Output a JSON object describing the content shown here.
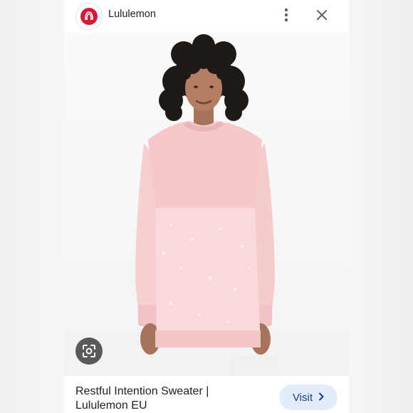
{
  "header": {
    "site_name": "Lululemon",
    "logo_icon": "lululemon-logo-icon",
    "menu_icon": "more-vert-icon",
    "close_icon": "close-icon"
  },
  "image": {
    "subject": "woman wearing long pink knit sweater",
    "lens_icon": "google-lens-icon"
  },
  "footer": {
    "title_line1": "Restful Intention Sweater |",
    "title_line2": "Lululemon EU",
    "visit_label": "Visit",
    "visit_icon": "chevron-right-icon"
  },
  "colors": {
    "brand_red": "#d31a38",
    "sweater_pink": "#f7cfd0",
    "visit_bg": "#e3ecfd",
    "visit_text": "#1a3d8f"
  }
}
